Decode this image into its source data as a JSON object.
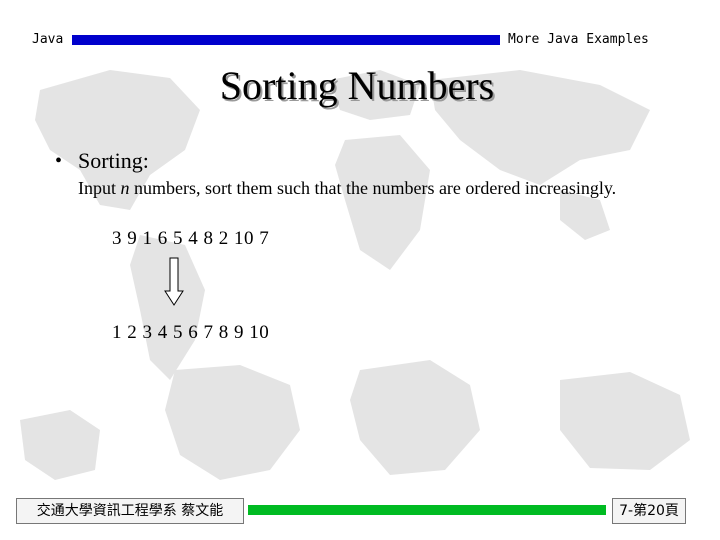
{
  "header": {
    "left_label": "Java",
    "right_label": "More Java Examples",
    "bar_color": "#0000cc"
  },
  "slide": {
    "title": "Sorting Numbers",
    "bullet": "Sorting:",
    "description_prefix": "Input ",
    "description_var": "n",
    "description_suffix": " numbers, sort them such that the numbers are ordered increasingly.",
    "unsorted_sequence": "3 9 1 6 5 4 8 2 10 7",
    "sorted_sequence": "1 2 3 4 5 6 7 8 9 10",
    "arrow_icon": "down-arrow-icon"
  },
  "footer": {
    "left_label": "交通大學資訊工程學系 蔡文能",
    "right_label": "7-第20頁",
    "bar_color": "#00bb22"
  }
}
